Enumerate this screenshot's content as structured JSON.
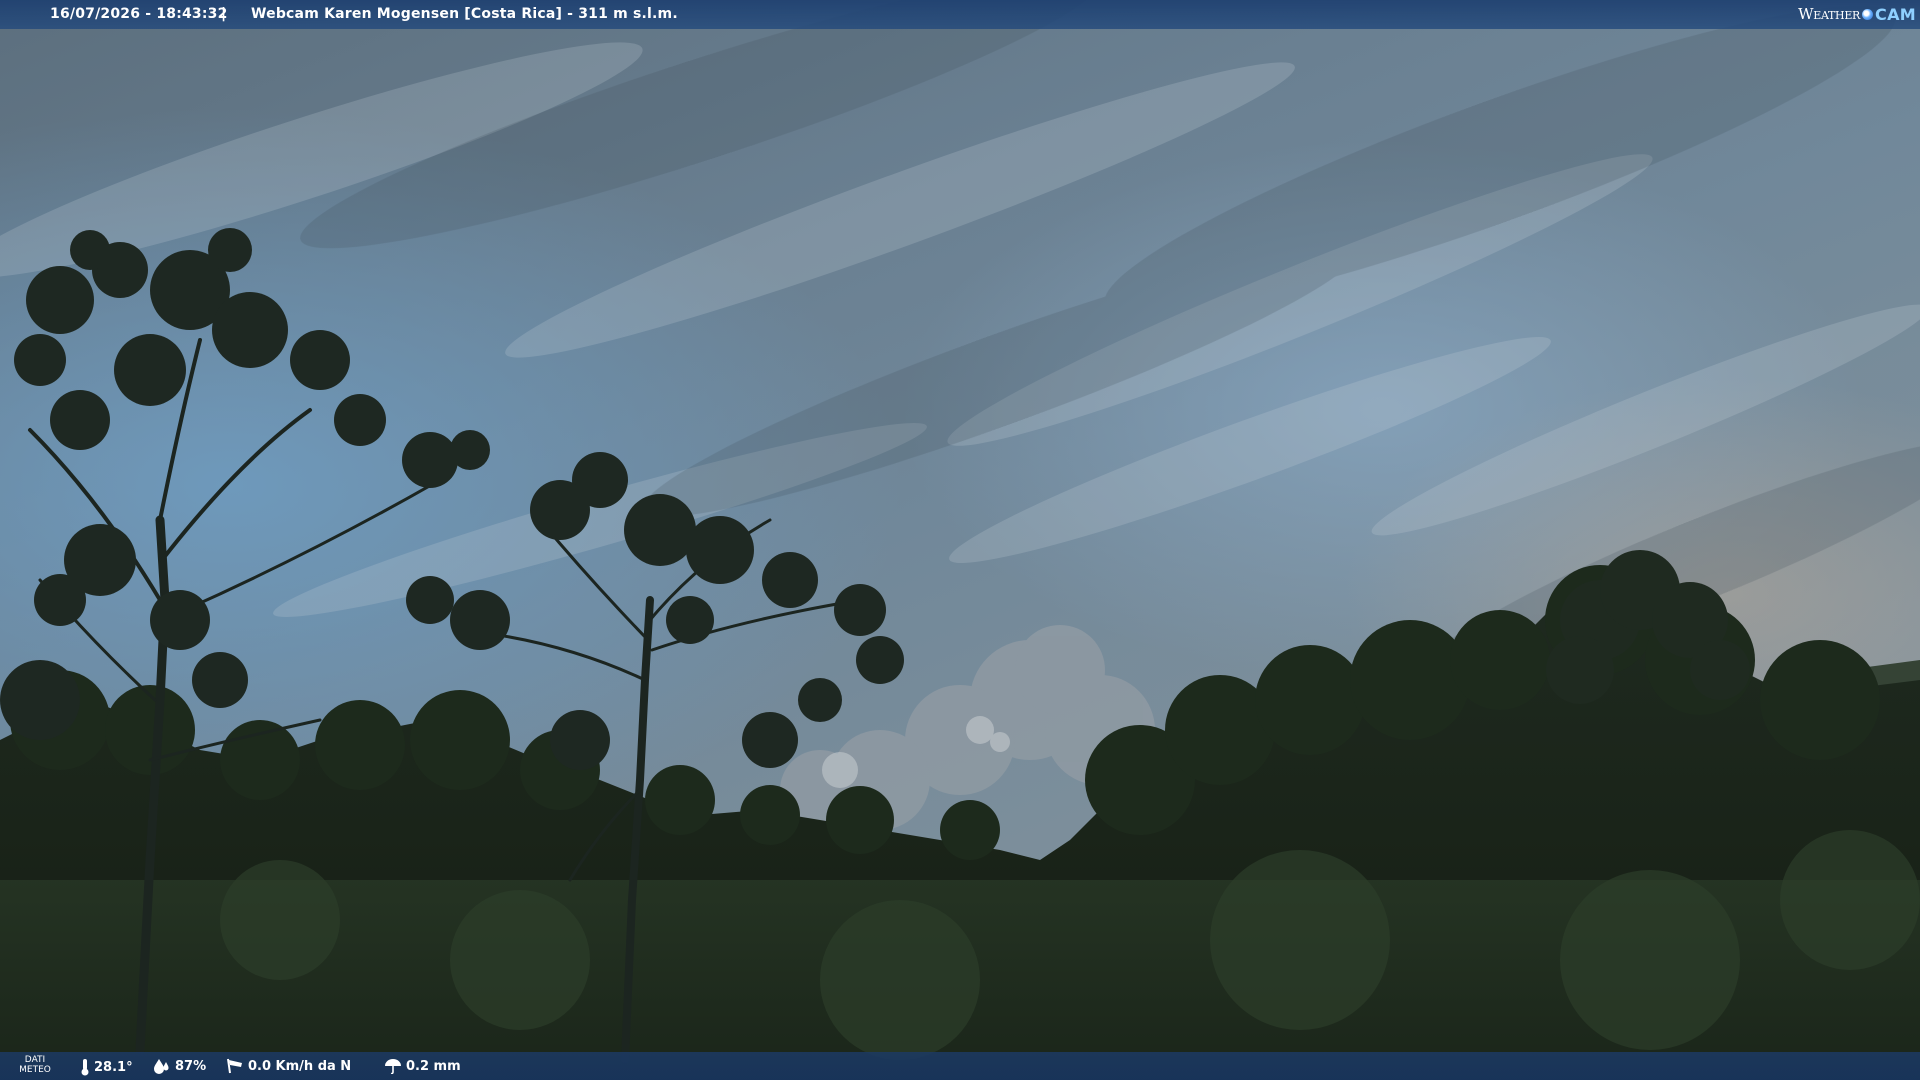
{
  "top_bar": {
    "timestamp": "16/07/2026 - 18:43:32",
    "separator": "|",
    "caption": "Webcam Karen Mogensen [Costa Rica]  - 311 m s.l.m.",
    "brand_weather": "Weather",
    "brand_cam": "CAM"
  },
  "bottom_bar": {
    "label_line1": "DATI",
    "label_line2": "METEO",
    "temperature": "28.1°",
    "humidity": "87%",
    "wind": "0.0 Km/h da N",
    "rain": "0.2 mm"
  },
  "icons": {
    "temperature": "thermometer-icon",
    "humidity": "humidity-drop-icon",
    "wind": "wind-sock-icon",
    "rain": "rain-umbrella-icon",
    "brand": "globe-dot-icon"
  },
  "colors": {
    "bar": "#1e4070",
    "brand_accent": "#8fd0ff",
    "text": "#ffffff"
  }
}
